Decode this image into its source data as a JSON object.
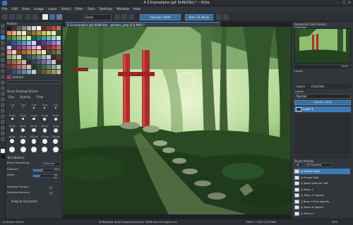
{
  "window": {
    "title": "4.3.0-prealpha (git 9c8b10e) *  – Krita"
  },
  "menu": [
    "File",
    "Edit",
    "View",
    "Image",
    "Layer",
    "Select",
    "Filter",
    "Tools",
    "Settings",
    "Window",
    "Help"
  ],
  "toolbar": {
    "blend_mode": "Erase",
    "opacity": "Opacity: 100%",
    "size": "Size: 21.00 px"
  },
  "left": {
    "palette_title": "Palette",
    "palette_name": "Untitled",
    "swatches": [
      "#1b1b1b",
      "#3a3a3a",
      "#5e5e5e",
      "#8a8a8a",
      "#b4b4b4",
      "#d9d9d9",
      "#ffffff",
      "#6b2a24",
      "#8d3b2f",
      "#a64e3a",
      "#c26b4b",
      "#e38a5d",
      "#ecb07e",
      "#f2d2a4",
      "#f7e9c6",
      "#6a5a22",
      "#8c7a2a",
      "#b29c35",
      "#d6c24c",
      "#e8de7a",
      "#f1ecb0",
      "#2b5b24",
      "#3e7b33",
      "#5a9a45",
      "#7cb85d",
      "#a7d38a",
      "#cfe8b8",
      "#1f5a53",
      "#2c7b70",
      "#3f9d8e",
      "#63bba8",
      "#94d3c2",
      "#c3e7dc",
      "#1f3f6a",
      "#2b5a91",
      "#3d77b6",
      "#5e98d3",
      "#8fb9e5",
      "#c1d9f1",
      "#3b2a6a",
      "#533c91",
      "#6c53b4",
      "#8f79cd",
      "#b5a5e0",
      "#d8cdef",
      "#6a2a55",
      "#8f3b72",
      "#b25291",
      "#cf74ad",
      "#e3a4c9",
      "#f1d0e2",
      "#7a1f1f",
      "#a12b2b",
      "#c73a3a",
      "#e55a5a",
      "#ef8c8c",
      "#f6c3c3",
      "#7a4a1f",
      "#a1652b",
      "#c7833a",
      "#e0a35a",
      "#ecc28c",
      "#f5e0c3",
      "#404f2a",
      "#56693a",
      "#6e854c",
      "#8ea465",
      "#b1c48e",
      "#d3e0bd",
      "#2a3f40",
      "#3a5557",
      "#4c6d70",
      "#69898c",
      "#94aeb0",
      "#c1d2d3",
      "#3f2b1c",
      "#5a3f29",
      "#775538",
      "#98704c",
      "#b99167",
      "#d8b893",
      "#2b2b3f",
      "#3e3e58",
      "#535375",
      "#6f6f96",
      "#9898b7",
      "#c4c4d8",
      "#502020",
      "#703030",
      "#904545",
      "#b06363",
      "#c98c8c",
      "#e0b7b7",
      "#1f3828",
      "#2d4f39",
      "#3e684c",
      "#598565",
      "#82a68b",
      "#b0c8b5",
      "#26384d",
      "#355069",
      "#476b87",
      "#6289a5",
      "#8aabc2",
      "#b7cdde",
      "#4d4126",
      "#6b5b36",
      "#8b7749",
      "#ab9563",
      "#c7b68b"
    ],
    "quick_settings": "Quick Settings Docker",
    "qs_tabs": [
      "Size",
      "Opacity",
      "Flow"
    ],
    "brush_sizes": [
      "1 px",
      "2 px",
      "3 px",
      "5 px",
      "7 px",
      "10 px",
      "15 px",
      "20 px",
      "25 px",
      "30 px",
      "35 px",
      "40 px",
      "50 px",
      "60 px",
      "70 px",
      "80 px",
      "90 px",
      "100 px",
      "120 px",
      "150 px",
      "",
      "",
      "",
      "",
      ""
    ],
    "tool_options": "Tool Options",
    "brush_smoothing": "Brush Smoothing:",
    "smoothing_value": "Stabilizer",
    "props": [
      {
        "label": "Distance:",
        "value": "50.0",
        "fill": 0.5
      },
      {
        "label": "Delay:",
        "value": "50 px",
        "fill": 0.35
      }
    ],
    "checks": [
      "Stabilize Sensors",
      "Scalable Distance"
    ],
    "snap": "Snap to Assistants"
  },
  "document": {
    "tab": "4.3.0-prealpha (git 9c8b10e) - gallows_jpeg (2.8 MiB) *"
  },
  "right": {
    "color_selector": "Advanced Color Select...",
    "overview_title": "Overview",
    "layers_label": "Layers",
    "layers_tabs": [
      "Layers",
      "Channels"
    ],
    "blending": "Normal",
    "opacity": "Opacity: 100%",
    "layers": [
      "Layer 1"
    ],
    "brush_presets_title": "Brush Presets",
    "preset_filter": "All",
    "preset_tag": "My Favorites",
    "presets": [
      "a) Eraser Small",
      "b) Eraser Soft",
      "c) Basic Airbrush Soft",
      "d) Basic-1",
      "e) Basic-2 Opacity",
      "f) Basic-5 Size Opacity",
      "g) Basic-6 Opacity",
      "h) Pencil-2"
    ],
    "zoom": "100%"
  },
  "status": {
    "brush": "a) Eraser Small",
    "colorspace": "RGB/Alpha (8-bit integer/channel)  sRGB-elle-V2-srgbtrc.icc",
    "dimensions": "1600 × 1024 (2.8 MiB)",
    "zoom": "50%"
  }
}
